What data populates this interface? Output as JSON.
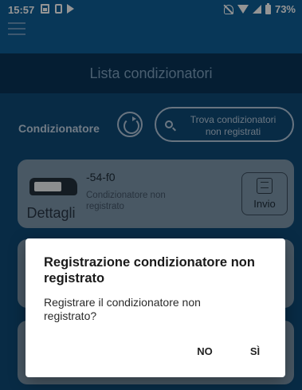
{
  "status_bar": {
    "time": "15:57",
    "battery": "73%",
    "icons": [
      "gallery-icon",
      "phone-icon",
      "play-icon",
      "mute-icon",
      "wifi-icon",
      "signal-icon",
      "battery-icon"
    ]
  },
  "app_bar": {
    "menu_icon": "hamburger-icon"
  },
  "header": {
    "title": "Lista condizionatori"
  },
  "toolbar": {
    "label": "Condizionatore",
    "refresh_icon": "refresh-icon",
    "find_button_line1": "Trova condizionatori",
    "find_button_line2": "non registrati",
    "find_icon": "search-icon"
  },
  "devices": [
    {
      "name": "-54-f0",
      "status": "Condizionatore non registrato",
      "details_label": "Dettagli",
      "send_label": "Invio"
    }
  ],
  "dialog": {
    "title": "Registrazione condizionatore non registrato",
    "message": "Registrare il condizionatore non registrato?",
    "no_label": "NO",
    "yes_label": "SÌ"
  },
  "colors": {
    "app_bar": "#0e5f98",
    "title_bar": "#0a3558",
    "background": "#0f4a78",
    "card": "#7f98ad",
    "dialog": "#ffffff"
  }
}
